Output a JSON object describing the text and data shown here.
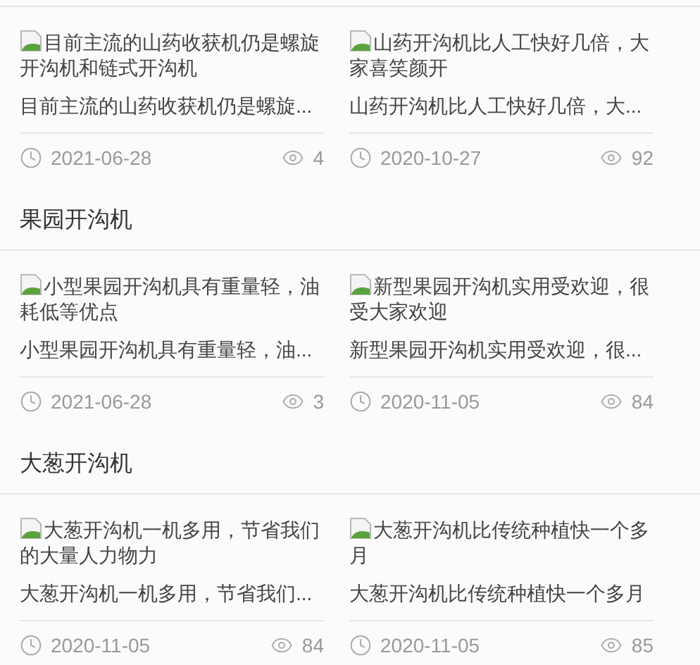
{
  "sections": [
    {
      "articles": [
        {
          "image_alt": "目前主流的山药收获机仍是螺旋开沟机和链式开沟机",
          "excerpt": "目前主流的山药收获机仍是螺旋...",
          "date": "2021-06-28",
          "views": "4"
        },
        {
          "image_alt": "山药开沟机比人工快好几倍，大家喜笑颜开",
          "excerpt": "山药开沟机比人工快好几倍，大...",
          "date": "2020-10-27",
          "views": "92"
        }
      ]
    },
    {
      "title": "果园开沟机",
      "articles": [
        {
          "image_alt": "小型果园开沟机具有重量轻，油耗低等优点",
          "excerpt": "小型果园开沟机具有重量轻，油...",
          "date": "2021-06-28",
          "views": "3"
        },
        {
          "image_alt": "新型果园开沟机实用受欢迎，很受大家欢迎",
          "excerpt": "新型果园开沟机实用受欢迎，很...",
          "date": "2020-11-05",
          "views": "84"
        }
      ]
    },
    {
      "title": "大葱开沟机",
      "articles": [
        {
          "image_alt": "大葱开沟机一机多用，节省我们的大量人力物力",
          "excerpt": "大葱开沟机一机多用，节省我们...",
          "date": "2020-11-05",
          "views": "84"
        },
        {
          "image_alt": "大葱开沟机比传统种植快一个多月",
          "excerpt": "大葱开沟机比传统种植快一个多月",
          "date": "2020-11-05",
          "views": "85"
        }
      ]
    }
  ]
}
